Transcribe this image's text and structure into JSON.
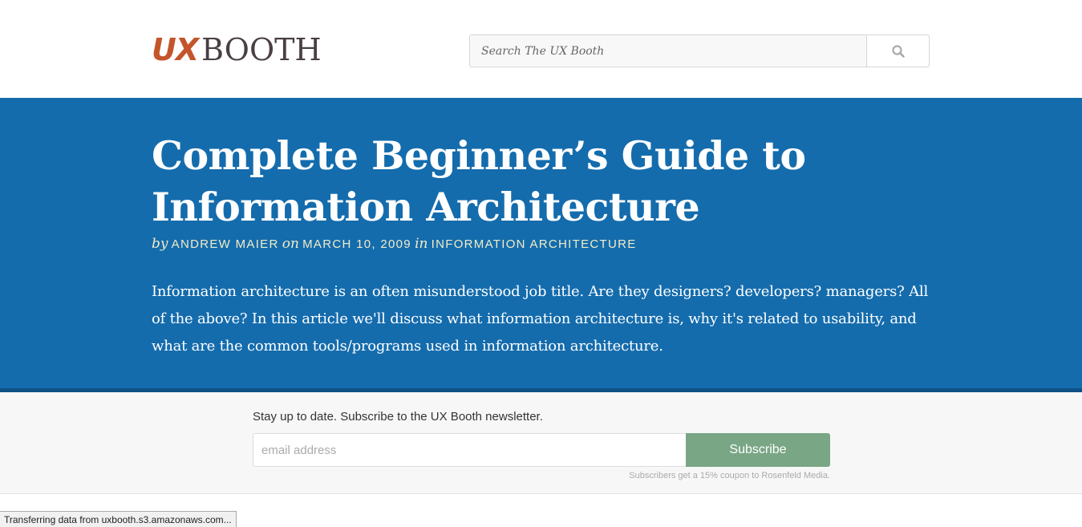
{
  "header": {
    "logo_ux": "UX",
    "logo_booth": "BOOTH",
    "search_placeholder": "Search The UX Booth",
    "search_icon": "search-icon"
  },
  "article": {
    "title": "Complete Beginner’s Guide to Information Architecture",
    "by_label": "by",
    "author": "ANDREW MAIER",
    "on_label": "on",
    "date": "MARCH 10, 2009",
    "in_label": "in",
    "category": "INFORMATION ARCHITECTURE",
    "summary": "Information architecture is an often misunderstood job title. Are they designers? developers? managers? All of the above? In this article we'll discuss what information architecture is, why it's related to usability, and what are the common tools/programs used in information architecture."
  },
  "newsletter": {
    "prompt": "Stay up to date. Subscribe to the UX Booth newsletter.",
    "email_placeholder": "email address",
    "subscribe_label": "Subscribe",
    "note": "Subscribers get a 15% coupon to Rosenfeld Media."
  },
  "status_bar": {
    "text": "Transferring data from uxbooth.s3.amazonaws.com..."
  },
  "colors": {
    "brand_orange": "#c4552a",
    "hero_blue": "#146cad",
    "byline_cream": "#f3ecc6",
    "subscribe_green": "#79a684"
  }
}
